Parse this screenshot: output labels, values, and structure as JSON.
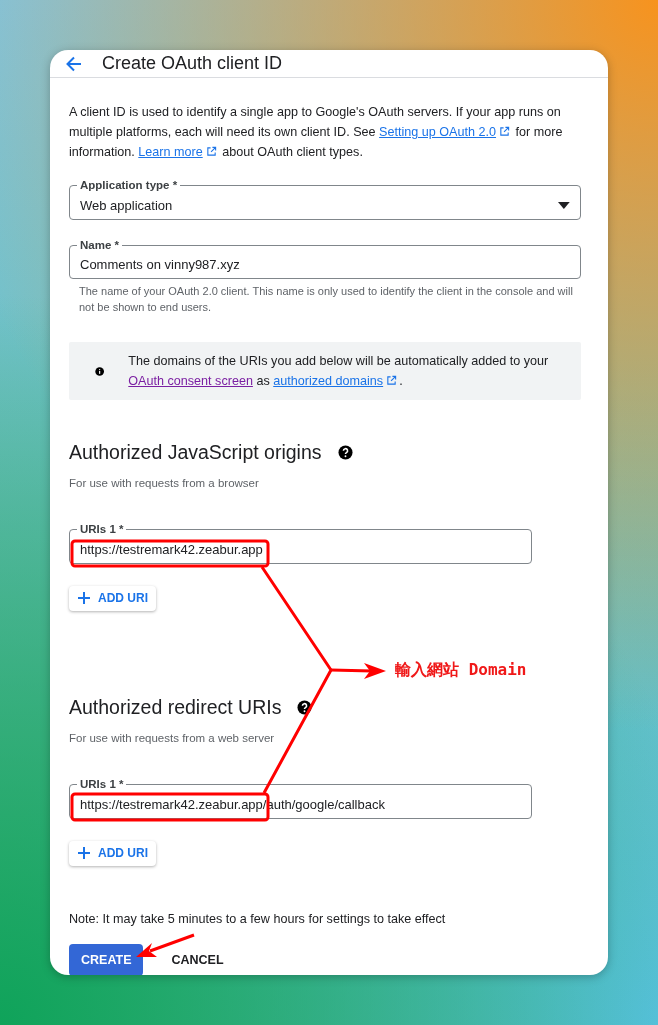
{
  "header": {
    "title": "Create OAuth client ID"
  },
  "intro": [
    {
      "kind": "text",
      "text": "A client ID is used to identify a single app to Google's OAuth servers. If your app runs on multiple platforms, each will need its own client ID. See "
    },
    {
      "kind": "link",
      "text": "Setting up OAuth 2.0",
      "external": true,
      "visited": false
    },
    {
      "kind": "text",
      "text": " for more information. "
    },
    {
      "kind": "link",
      "text": "Learn more",
      "external": true,
      "visited": false
    },
    {
      "kind": "text",
      "text": " about OAuth client types."
    }
  ],
  "application_type": {
    "label": "Application type *",
    "value": "Web application"
  },
  "name_field": {
    "label": "Name *",
    "value": "Comments on vinny987.xyz",
    "helper": "The name of your OAuth 2.0 client. This name is only used to identify the client in the console and will not be shown to end users."
  },
  "info": [
    {
      "kind": "text",
      "text": "The domains of the URIs you add below will be automatically added to your "
    },
    {
      "kind": "link",
      "text": "OAuth consent screen",
      "external": false,
      "visited": true
    },
    {
      "kind": "text",
      "text": " as "
    },
    {
      "kind": "link",
      "text": "authorized domains",
      "external": true,
      "visited": false
    },
    {
      "kind": "text",
      "text": "."
    }
  ],
  "sections": [
    {
      "title": "Authorized JavaScript origins",
      "subtitle": "For use with requests from a browser",
      "uris": [
        {
          "label": "URIs 1 *",
          "value": "https://testremark42.zeabur.app"
        }
      ],
      "add_button": "ADD URI"
    },
    {
      "title": "Authorized redirect URIs",
      "subtitle": "For use with requests from a web server",
      "uris": [
        {
          "label": "URIs 1 *",
          "value": "https://testremark42.zeabur.app/auth/google/callback"
        }
      ],
      "add_button": "ADD URI"
    }
  ],
  "note": "Note: It may take 5 minutes to a few hours for settings to take effect",
  "buttons": [
    {
      "label": "CREATE",
      "kind": "primary"
    },
    {
      "label": "CANCEL",
      "kind": "text"
    }
  ],
  "annotation": {
    "label": "輸入網站 Domain"
  }
}
